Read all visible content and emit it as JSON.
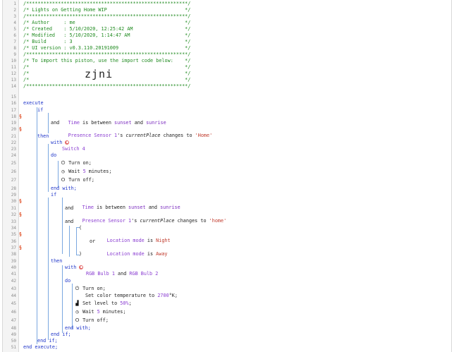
{
  "header_comment": [
    "/********************************************************/",
    "/* Lights on Getting Home WIP                           */",
    "/********************************************************/",
    "/* Author     : me                                      */",
    "/* Created    : 5/10/2020, 12:25:42 AM                  */",
    "/* Modified   : 5/10/2020, 1:14:47 AM                   */",
    "/* Build      : 3                                       */",
    "/* UI version : v0.3.110.20191009                       */",
    "/********************************************************/",
    "/* To import this piston, use the import code below:    */",
    "/*                                                      */",
    "/*                                                      */",
    "/*                                                      */",
    "/********************************************************/"
  ],
  "import_code": "zjni",
  "line_numbers": [
    "1",
    "2",
    "3",
    "4",
    "5",
    "6",
    "7",
    "8",
    "9",
    "10",
    "11",
    "12",
    "13",
    "14",
    "15",
    "16",
    "17",
    "18",
    "19",
    "20",
    "21",
    "22",
    "23",
    "24",
    "25",
    "26",
    "27",
    "28",
    "29",
    "30",
    "31",
    "32",
    "33",
    "34",
    "35",
    "36",
    "37",
    "38",
    "39",
    "40",
    "41",
    "42",
    "43",
    "44",
    "45",
    "46",
    "47",
    "48",
    "49",
    "50",
    "51"
  ],
  "marker_lines": [
    18,
    20,
    30,
    32,
    35,
    37
  ],
  "code": {
    "execute": "execute",
    "if": "if",
    "time": "Time",
    "is_between": "is between",
    "sunset": "sunset",
    "and": "and",
    "sunrise": "sunrise",
    "and_kw": "and",
    "presence": "Presence Sensor 1",
    "s": "'s",
    "current_place": "currentPlace",
    "changes_to": "changes to",
    "home1": "'Home'",
    "then": "then",
    "with": "with",
    "switch4": "Switch 4",
    "do": "do",
    "turn_on": "Turn on;",
    "wait5_a": "Wait",
    "five": "5",
    "minutes": "minutes;",
    "turn_off": "Turn off;",
    "end_with": "end with;",
    "if2": "if",
    "home2": "'home'",
    "open_paren": "(",
    "location_mode": "Location mode",
    "is": "is",
    "night": "Night",
    "or": "or",
    "away": "Away",
    "close_paren": ")",
    "then2": "then",
    "rgb1": "RGB Bulb 1",
    "rgb2": "RGB Bulb 2",
    "set_color_temp": "Set color temperature to",
    "k2700": "2700",
    "kelvin": "°K;",
    "set_level": "Set level to",
    "pct50": "50%",
    "semicolon": ";",
    "end_if": "end if;",
    "end_execute": "end execute;"
  },
  "icons": {
    "power": "power-icon",
    "clock": "clock-icon",
    "level": "level-icon",
    "device": "device-icon"
  }
}
